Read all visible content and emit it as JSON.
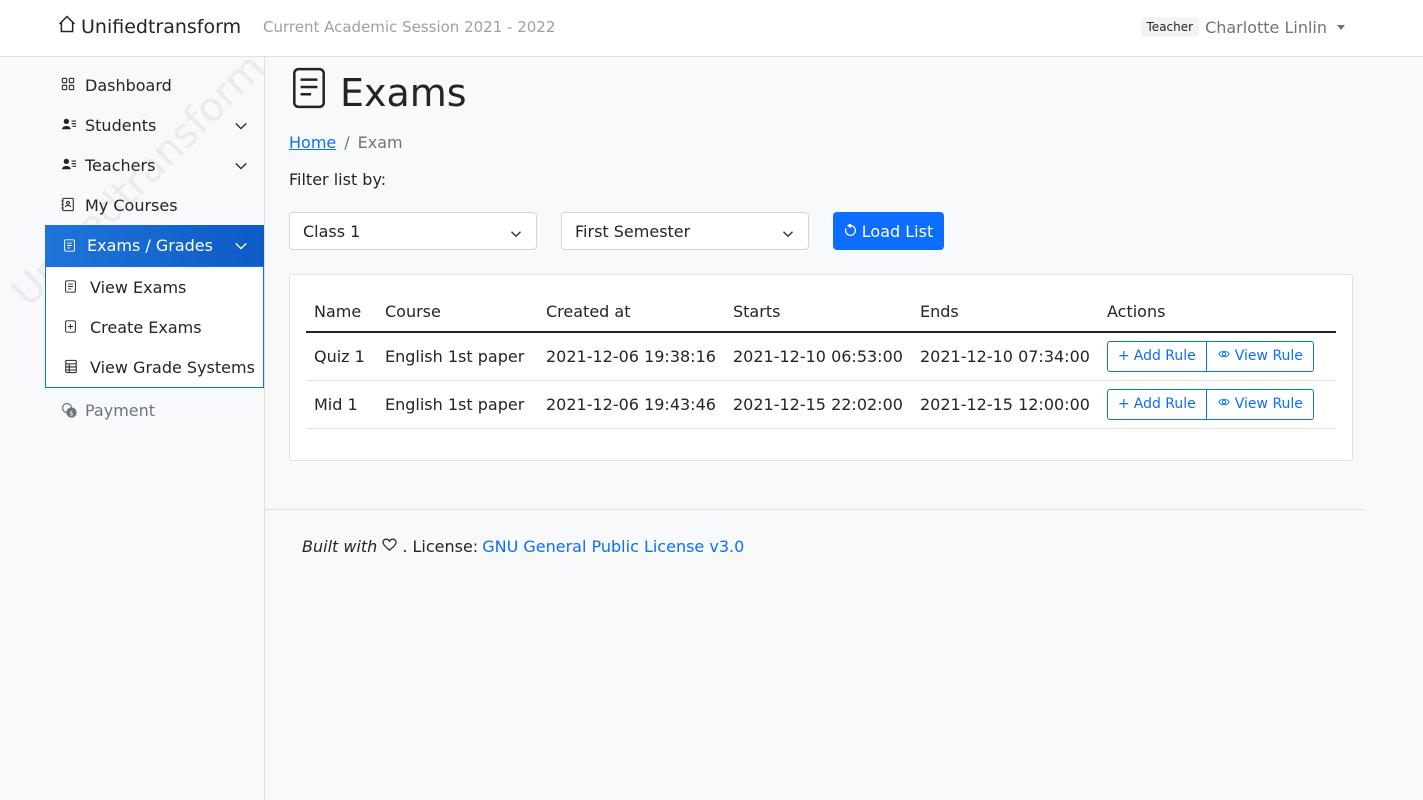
{
  "brand": {
    "name": "Unifiedtransform",
    "icon": "house-icon"
  },
  "session": "Current Academic Session 2021 - 2022",
  "user": {
    "role": "Teacher",
    "name": "Charlotte Linlin"
  },
  "sidebar": {
    "watermark": "Unifiedtransform",
    "items": [
      {
        "label": "Dashboard",
        "icon": "grid-icon"
      },
      {
        "label": "Students",
        "icon": "person-lines-icon"
      },
      {
        "label": "Teachers",
        "icon": "person-lines-icon"
      },
      {
        "label": "My Courses",
        "icon": "journal-icon"
      },
      {
        "label": "Exams / Grades",
        "icon": "file-text-icon"
      },
      {
        "label": "Payment",
        "icon": "coin-icon"
      }
    ],
    "submenu": [
      {
        "label": "View Exams",
        "icon": "file-text-icon"
      },
      {
        "label": "Create Exams",
        "icon": "file-plus-icon"
      },
      {
        "label": "View Grade Systems",
        "icon": "table-icon"
      }
    ]
  },
  "page": {
    "title": "Exams",
    "breadcrumb": {
      "home": "Home",
      "current": "Exam"
    },
    "filter_label": "Filter list by:",
    "class_select": "Class 1",
    "semester_select": "First Semester",
    "load_button": "Load List"
  },
  "table": {
    "headers": [
      "Name",
      "Course",
      "Created at",
      "Starts",
      "Ends",
      "Actions"
    ],
    "rows": [
      {
        "name": "Quiz 1",
        "course": "English 1st paper",
        "created": "2021-12-06 19:38:16",
        "starts": "2021-12-10 06:53:00",
        "ends": "2021-12-10 07:34:00"
      },
      {
        "name": "Mid 1",
        "course": "English 1st paper",
        "created": "2021-12-06 19:43:46",
        "starts": "2021-12-15 22:02:00",
        "ends": "2021-12-15 12:00:00"
      }
    ],
    "add_rule": "Add Rule",
    "view_rule": "View Rule"
  },
  "footer": {
    "built_with": "Built with",
    "license_label": ". License:",
    "license_link": "GNU General Public License v3.0"
  },
  "colors": {
    "primary": "#0d6efd",
    "active_start": "#1f74d9",
    "active_end": "#0d5bc5"
  }
}
